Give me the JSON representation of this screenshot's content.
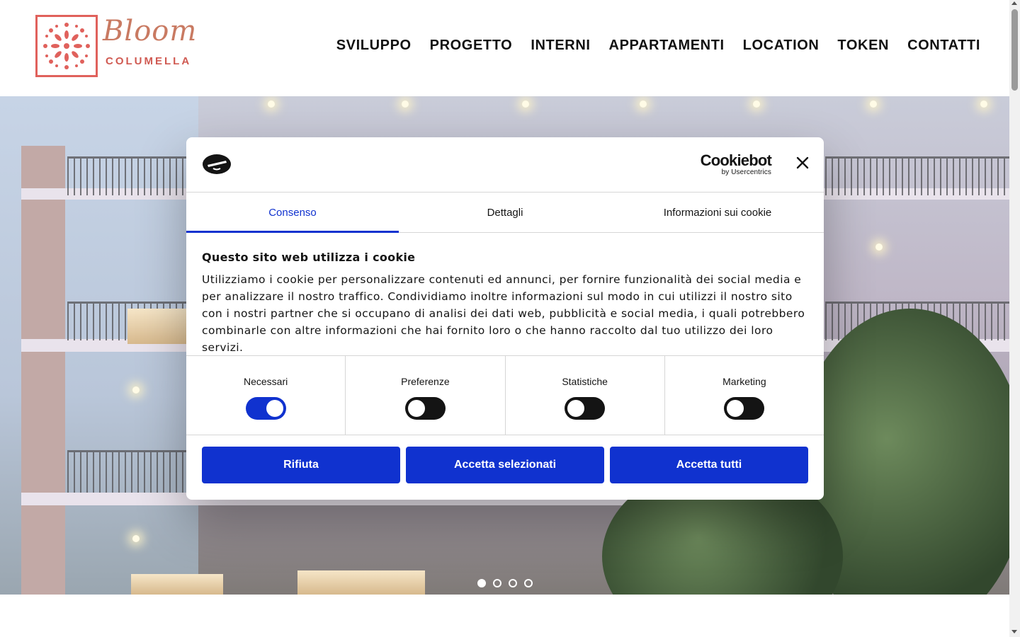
{
  "brand": {
    "logo_script": "Bloom",
    "logo_sub": "COLUMELLA"
  },
  "nav": {
    "items": [
      {
        "label": "SVILUPPO"
      },
      {
        "label": "PROGETTO"
      },
      {
        "label": "INTERNI"
      },
      {
        "label": "APPARTAMENTI"
      },
      {
        "label": "LOCATION"
      },
      {
        "label": "TOKEN"
      },
      {
        "label": "CONTATTI"
      }
    ]
  },
  "hero": {
    "slides_count": 4,
    "active_slide": 1
  },
  "cookie_dialog": {
    "provider_name": "Cookiebot",
    "provider_sub": "by Usercentrics",
    "tabs": [
      {
        "label": "Consenso",
        "active": true
      },
      {
        "label": "Dettagli",
        "active": false
      },
      {
        "label": "Informazioni sui cookie",
        "active": false
      }
    ],
    "title": "Questo sito web utilizza i cookie",
    "text": "Utilizziamo i cookie per personalizzare contenuti ed annunci, per fornire funzionalità dei social media e per analizzare il nostro traffico. Condividiamo inoltre informazioni sul modo in cui utilizzi il nostro sito con i nostri partner che si occupano di analisi dei dati web, pubblicità e social media, i quali potrebbero combinarle con altre informazioni che hai fornito loro o che hanno raccolto dal tuo utilizzo dei loro servizi.",
    "toggles": [
      {
        "label": "Necessari",
        "on": true
      },
      {
        "label": "Preferenze",
        "on": false
      },
      {
        "label": "Statistiche",
        "on": false
      },
      {
        "label": "Marketing",
        "on": false
      }
    ],
    "buttons": {
      "reject": "Rifiuta",
      "accept_selected": "Accetta selezionati",
      "accept_all": "Accetta tutti"
    }
  },
  "colors": {
    "accent_blue": "#1032cf",
    "brand_red": "#e0615c",
    "brand_copper": "#c97a62"
  }
}
